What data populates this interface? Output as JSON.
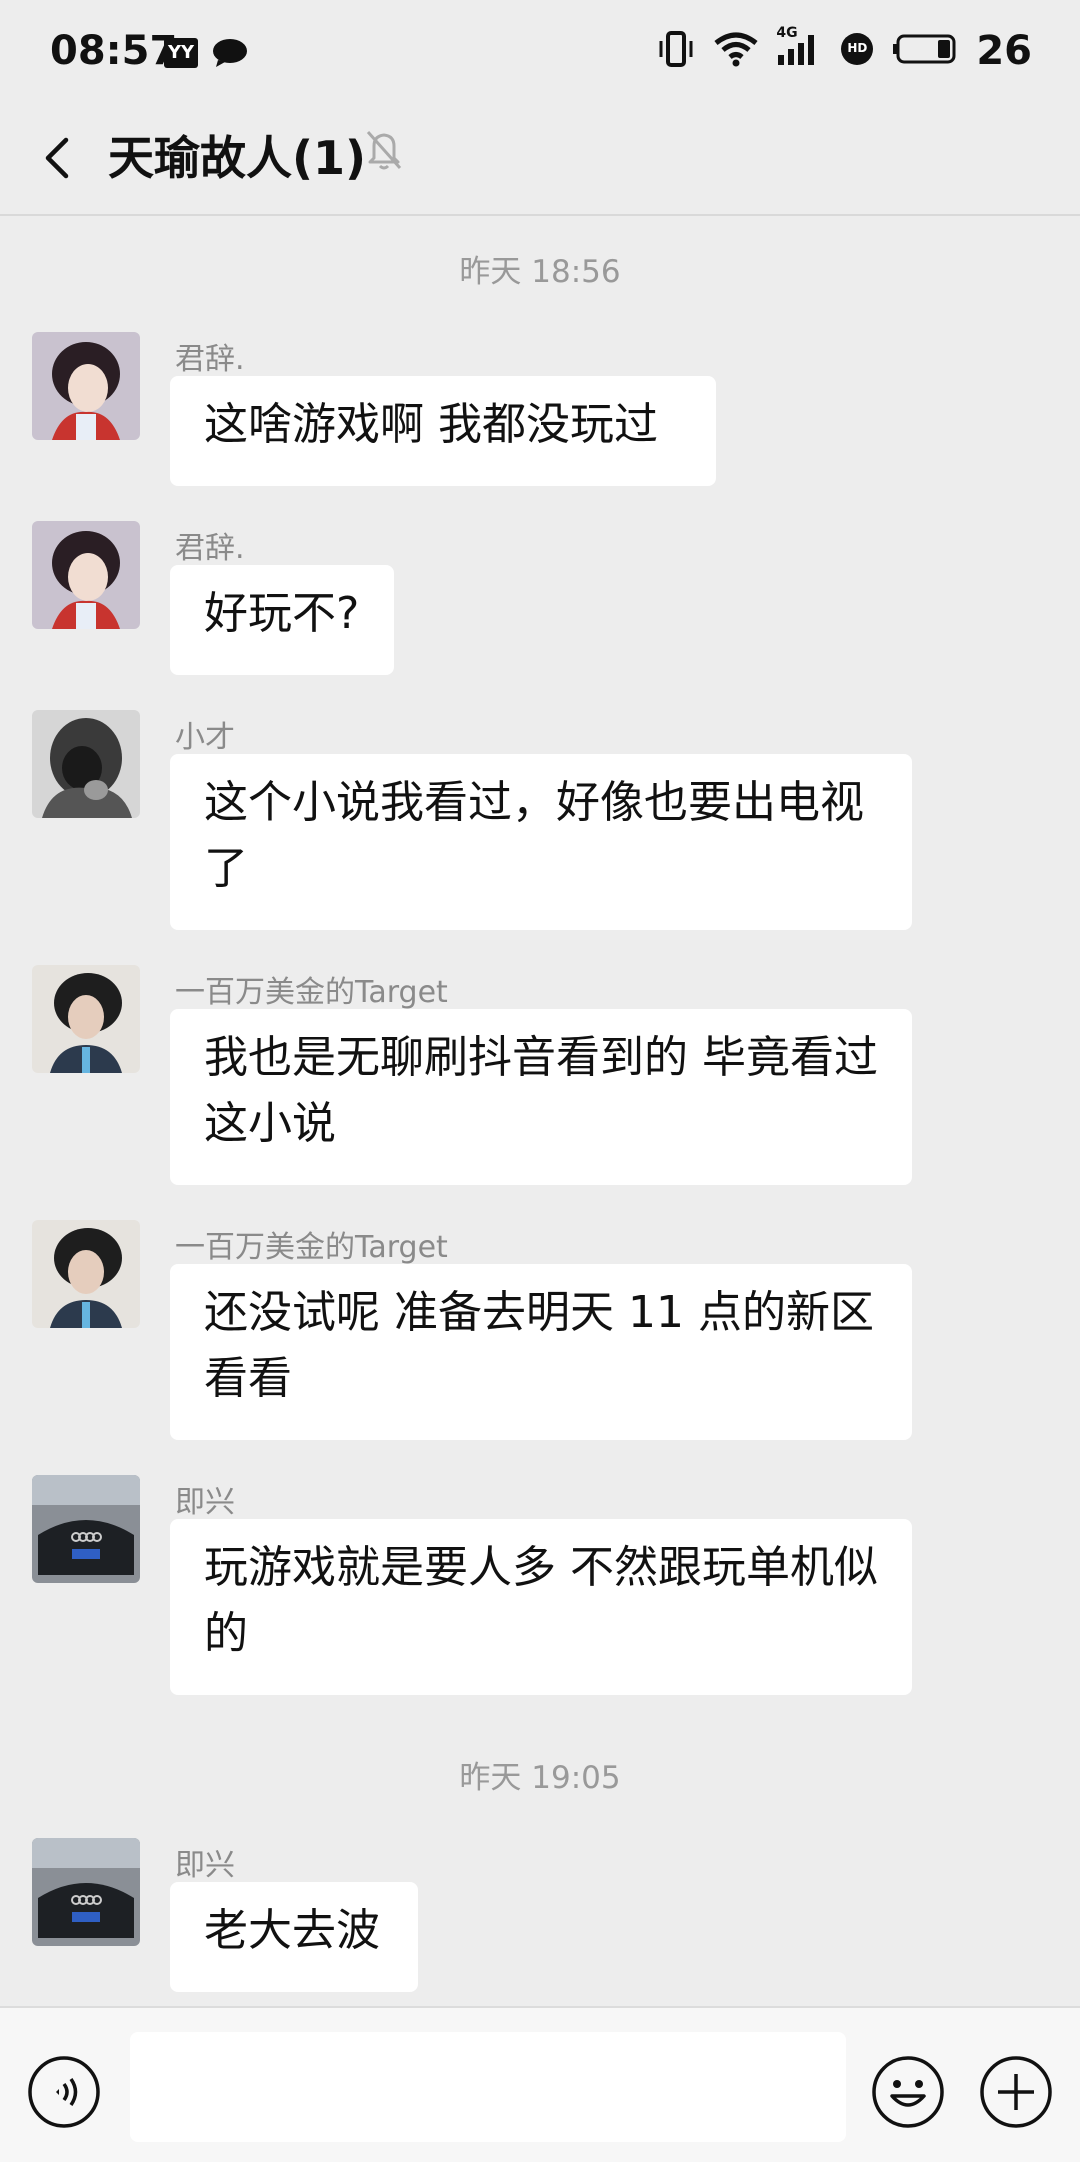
{
  "status_bar": {
    "time": "08:57",
    "app_icon_text": "YY",
    "battery_percent": "26",
    "network_label": "4G",
    "hd_label": "HD"
  },
  "nav": {
    "title": "天瑜故人(1)"
  },
  "chat": {
    "time_separators": [
      "昨天 18:56",
      "昨天 19:05"
    ],
    "messages": [
      {
        "sender": "君辞.",
        "text": "这啥游戏啊  我都没玩过"
      },
      {
        "sender": "君辞.",
        "text": "好玩不?"
      },
      {
        "sender": "小才",
        "text": "这个小说我看过，好像也要出电视了"
      },
      {
        "sender": "一百万美金的Target",
        "text": "我也是无聊刷抖音看到的 毕竟看过这小说"
      },
      {
        "sender": "一百万美金的Target",
        "text": "还没试呢 准备去明天 11 点的新区看看"
      },
      {
        "sender": "即兴",
        "text": "玩游戏就是要人多 不然跟玩单机似的"
      },
      {
        "sender": "即兴",
        "text": "老大去波"
      }
    ]
  },
  "input_bar": {
    "placeholder": ""
  },
  "colors": {
    "background": "#ededed",
    "bubble": "#ffffff",
    "secondary_text": "#999999"
  }
}
